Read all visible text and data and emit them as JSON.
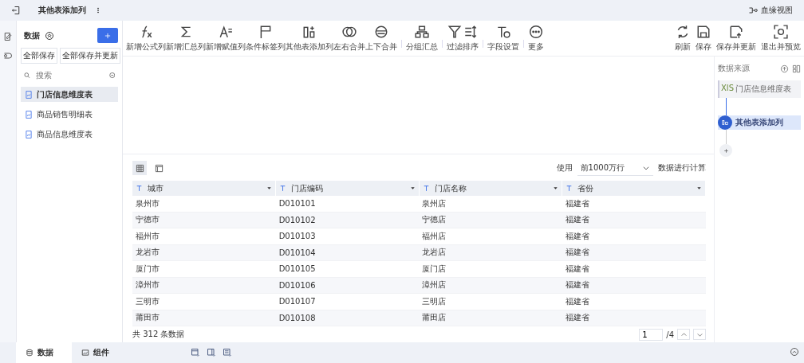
{
  "topbar": {
    "title": "其他表添加列",
    "lineage": "血缘视图"
  },
  "sidebar": {
    "title": "数据",
    "save_all": "全部保存",
    "save_all_update": "全部保存并更新",
    "search": {
      "placeholder": "搜索"
    },
    "items": [
      {
        "label": "门店信息维度表",
        "selected": true
      },
      {
        "label": "商品销售明细表",
        "selected": false
      },
      {
        "label": "商品信息维度表",
        "selected": false
      }
    ]
  },
  "toolbar": {
    "groups": [
      [
        "新增公式列",
        "新增汇总列",
        "新增赋值列",
        "条件标签列",
        "其他表添加列",
        "左右合并",
        "上下合并"
      ],
      [
        "分组汇总"
      ],
      [
        "过滤",
        "排序"
      ],
      [
        "字段设置"
      ],
      [
        "更多"
      ]
    ],
    "actions": [
      "刷新",
      "保存",
      "保存并更新",
      "退出并预览"
    ]
  },
  "preview": {
    "use_label": "使用",
    "row_limit": "前1000万行",
    "calc_label": "数据进行计算",
    "columns": [
      "城市",
      "门店编码",
      "门店名称",
      "省份"
    ],
    "rows": [
      [
        "泉州市",
        "D010101",
        "泉州店",
        "福建省"
      ],
      [
        "宁德市",
        "D010102",
        "宁德店",
        "福建省"
      ],
      [
        "福州市",
        "D010103",
        "福州店",
        "福建省"
      ],
      [
        "龙岩市",
        "D010104",
        "龙岩店",
        "福建省"
      ],
      [
        "厦门市",
        "D010105",
        "厦门店",
        "福建省"
      ],
      [
        "漳州市",
        "D010106",
        "漳州店",
        "福建省"
      ],
      [
        "三明市",
        "D010107",
        "三明店",
        "福建省"
      ],
      [
        "莆田市",
        "D010108",
        "莆田店",
        "福建省"
      ]
    ],
    "total": "共 312 条数据",
    "page": "1",
    "pages": "/4"
  },
  "flow": {
    "title": "数据来源",
    "source_badge": "XlS",
    "source": "门店信息维度表",
    "steps": [
      {
        "label": "其他表添加列",
        "selected": true
      }
    ]
  },
  "bottom_tabs": [
    {
      "label": "数据",
      "selected": true
    },
    {
      "label": "组件",
      "selected": false
    }
  ]
}
